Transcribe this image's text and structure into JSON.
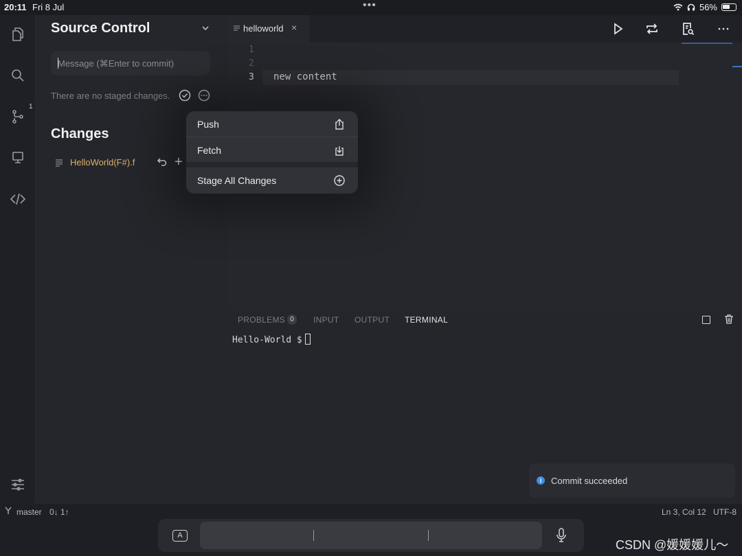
{
  "status": {
    "time": "20:11",
    "date": "Fri 8 Jul",
    "battery": "56%"
  },
  "sidebar": {
    "title": "Source Control",
    "message_placeholder": "Message (⌘Enter to commit)",
    "no_staged": "There are no staged changes.",
    "changes_title": "Changes",
    "files": [
      {
        "name": "HelloWorld(F#).f"
      }
    ]
  },
  "activity": {
    "scm_badge": "1"
  },
  "editor": {
    "tab_label": "helloworld",
    "tab_close": "×",
    "lines": [
      "1",
      "2",
      "3"
    ],
    "code_line3": "new content"
  },
  "panel": {
    "tabs": [
      "PROBLEMS",
      "INPUT",
      "OUTPUT",
      "TERMINAL"
    ],
    "problems_count": "0",
    "terminal_prompt": "Hello-World $"
  },
  "menu": {
    "items": [
      "Push",
      "Fetch",
      "Stage All Changes"
    ]
  },
  "toast": {
    "text": "Commit succeeded"
  },
  "statusbar": {
    "branch": "master",
    "sync": "0↓ 1↑",
    "position": "Ln 3, Col 12",
    "encoding": "UTF-8"
  },
  "keyboard": {
    "a_label": "A"
  },
  "watermark": "CSDN @媛媛媛儿～",
  "colors": {
    "accent": "#3b8eea",
    "modified_file": "#d9b26b",
    "background": "#1e1f24"
  }
}
